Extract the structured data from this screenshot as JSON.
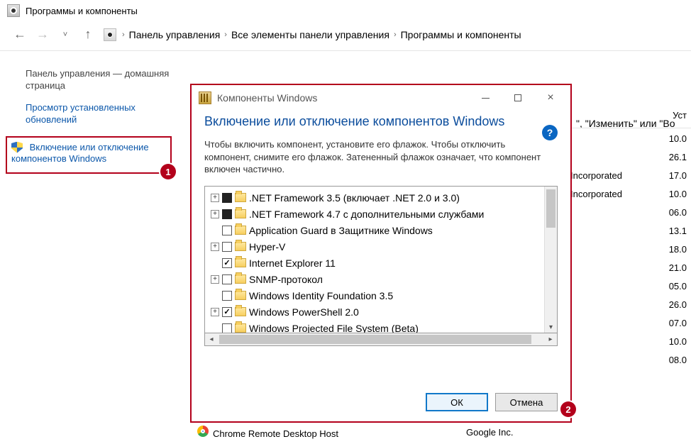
{
  "window": {
    "title": "Программы и компоненты"
  },
  "breadcrumb": {
    "items": [
      "Панель управления",
      "Все элементы панели управления",
      "Программы и компоненты"
    ]
  },
  "sidebar": {
    "home": "Панель управления — домашняя страница",
    "updates": "Просмотр установленных обновлений",
    "features": "Включение или отключение компонентов Windows"
  },
  "bg_hint": "\", \"Изменить\" или \"Во",
  "bg_table": {
    "header": "Уст",
    "publisher1": "Incorporated",
    "publisher2": "Incorporated",
    "dates": [
      "10.0",
      "26.1",
      "17.0",
      "10.0",
      "06.0",
      "13.1",
      "18.0",
      "21.0",
      "05.0",
      "26.0",
      "07.0",
      "10.0",
      "08.0"
    ]
  },
  "dialog": {
    "title": "Компоненты Windows",
    "heading": "Включение или отключение компонентов Windows",
    "description": "Чтобы включить компонент, установите его флажок. Чтобы отключить компонент, снимите его флажок. Затененный флажок означает, что компонент включен частично.",
    "ok": "ОК",
    "cancel": "Отмена",
    "items": [
      {
        "exp": true,
        "check": "filled",
        "label": ".NET Framework 3.5 (включает .NET 2.0 и 3.0)"
      },
      {
        "exp": true,
        "check": "filled",
        "label": ".NET Framework 4.7 с дополнительными службами"
      },
      {
        "exp": false,
        "check": "empty",
        "label": "Application Guard в Защитнике Windows"
      },
      {
        "exp": true,
        "check": "empty",
        "label": "Hyper-V"
      },
      {
        "exp": false,
        "check": "checked",
        "label": "Internet Explorer 11"
      },
      {
        "exp": true,
        "check": "empty",
        "label": "SNMP-протокол"
      },
      {
        "exp": false,
        "check": "empty",
        "label": "Windows Identity Foundation 3.5"
      },
      {
        "exp": true,
        "check": "checked",
        "label": "Windows PowerShell 2.0"
      },
      {
        "exp": false,
        "check": "empty",
        "label": "Windows Projected File System (Beta)"
      }
    ]
  },
  "extra": {
    "program": "Chrome Remote Desktop Host",
    "publisher": "Google Inc."
  },
  "callouts": {
    "one": "1",
    "two": "2"
  }
}
